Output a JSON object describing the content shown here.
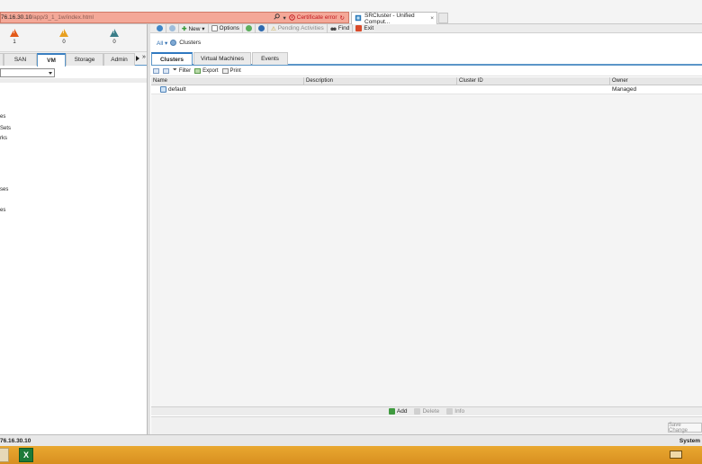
{
  "browser": {
    "url_host": "76.16.30.10",
    "url_path": "/app/3_1_1w/index.html",
    "cert_error": "Certificate error",
    "tab_title": "SRCluster - Unified Comput...",
    "tab_close": "×"
  },
  "alarms": [
    {
      "icon": "critical-alarm-icon",
      "count": "1",
      "color": "#e35a1a"
    },
    {
      "icon": "major-alarm-icon",
      "count": "0",
      "color": "#e8a020"
    },
    {
      "icon": "minor-alarm-icon",
      "count": "0",
      "color": "#3a7d88"
    }
  ],
  "left_tabs": {
    "items": [
      "SAN",
      "VM",
      "Storage",
      "Admin"
    ],
    "active": "VM",
    "more": "»"
  },
  "tree": {
    "items": [
      "es",
      "Sets",
      "rks",
      "ses",
      "es"
    ]
  },
  "toolbar": {
    "new": "New ▾",
    "options": "Options",
    "pending": "Pending Activities",
    "find": "Find",
    "exit": "Exit"
  },
  "breadcrumb": {
    "all": "All ▾",
    "current": "Clusters"
  },
  "right_tabs": {
    "items": [
      "Clusters",
      "Virtual Machines",
      "Events"
    ],
    "active": "Clusters"
  },
  "grid_toolbar": {
    "filter": "Filter",
    "export": "Export",
    "print": "Print"
  },
  "grid": {
    "columns": [
      "Name",
      "Description",
      "Cluster ID",
      "Owner"
    ],
    "rows": [
      {
        "name": "default",
        "description": "",
        "cluster_id": "",
        "owner": "Managed"
      }
    ]
  },
  "actions": {
    "add": "Add",
    "delete": "Delete",
    "info": "Info"
  },
  "save_changes": "Save Change",
  "status": {
    "left": "76.16.30.10",
    "right": "System"
  },
  "colors": {
    "accent": "#3a7fc1",
    "address_bar_error": "#f4a898",
    "taskbar": "#e19b28"
  }
}
